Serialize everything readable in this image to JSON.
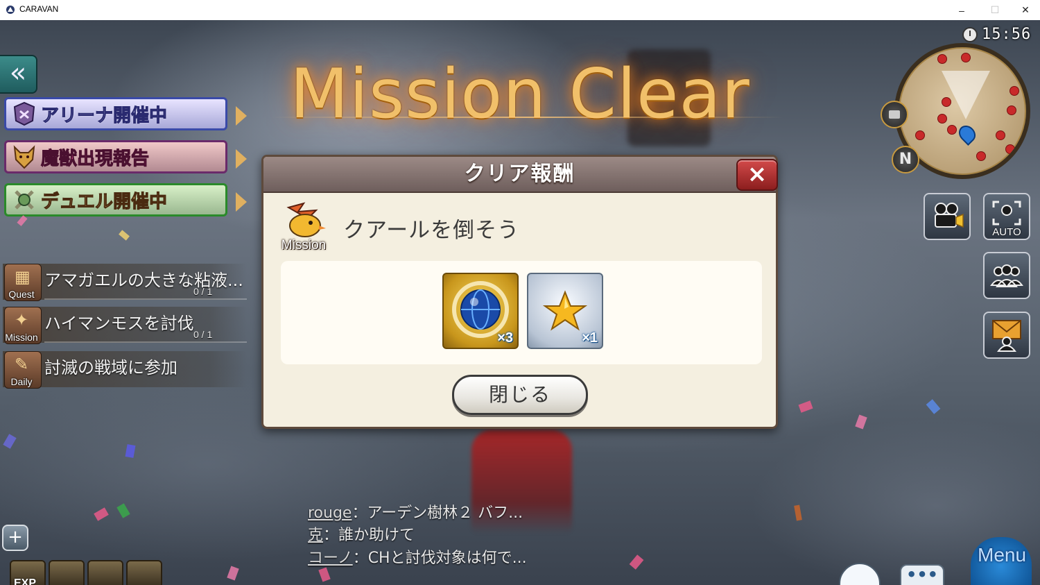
{
  "window": {
    "title": "CARAVAN",
    "minimize": "–",
    "maximize": "☐",
    "close": "✕"
  },
  "header_title": "Mission Clear",
  "clock": "15:56",
  "banners": [
    {
      "label": "アリーナ開催中",
      "icon": "arena-icon"
    },
    {
      "label": "魔獣出現報告",
      "icon": "beast-icon"
    },
    {
      "label": "デュエル開催中",
      "icon": "duel-icon"
    }
  ],
  "quests": [
    {
      "tag": "Quest",
      "title": "アマガエルの大きな粘液...",
      "progress": "0 / 1"
    },
    {
      "tag": "Mission",
      "title": "ハイマンモスを討伐",
      "progress": "0 / 1"
    },
    {
      "tag": "Daily",
      "title": "討滅の戦域に参加",
      "progress": ""
    }
  ],
  "modal": {
    "title": "クリア報酬",
    "close_icon": "×",
    "badge_label": "Mission",
    "mission_name": "クアールを倒そう",
    "rewards": [
      {
        "icon": "globe-orb-icon",
        "quantity": "×3"
      },
      {
        "icon": "star-icon",
        "quantity": "×1"
      }
    ],
    "close_button": "閉じる"
  },
  "map": {
    "north": "N"
  },
  "hud": {
    "auto_label": "AUTO"
  },
  "chat": [
    {
      "name": "rouge",
      "message": "：アーデン樹林２ バフ..."
    },
    {
      "name": "克",
      "message": "：誰か助けて"
    },
    {
      "name": "コーノ",
      "message": "：CHと討伐対象は何で..."
    }
  ],
  "bottom": {
    "exp_label": "EXP",
    "menu_label": "Menu",
    "plus": "+",
    "chat_dots": "•••"
  },
  "colors": {
    "mission_gold": "#f1c06a",
    "modal_bg": "#f4efe0",
    "close_red": "#c83232"
  }
}
